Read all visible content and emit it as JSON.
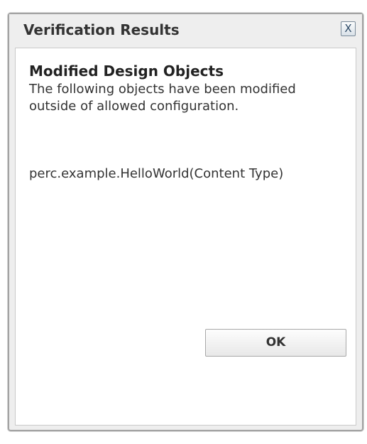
{
  "dialog": {
    "title": "Verification Results",
    "close_label": "X",
    "heading": "Modified Design Objects",
    "description": "The following objects have been modified outside of allowed configuration.",
    "object_name": "perc.example.HelloWorld(Content Type)",
    "ok_label": "OK"
  },
  "colors": {
    "title_bar": "#eeeeee",
    "border": "#a3a3a3",
    "content_background": "#ffffff",
    "text": "#333333",
    "close_icon": "#2d4a66"
  }
}
